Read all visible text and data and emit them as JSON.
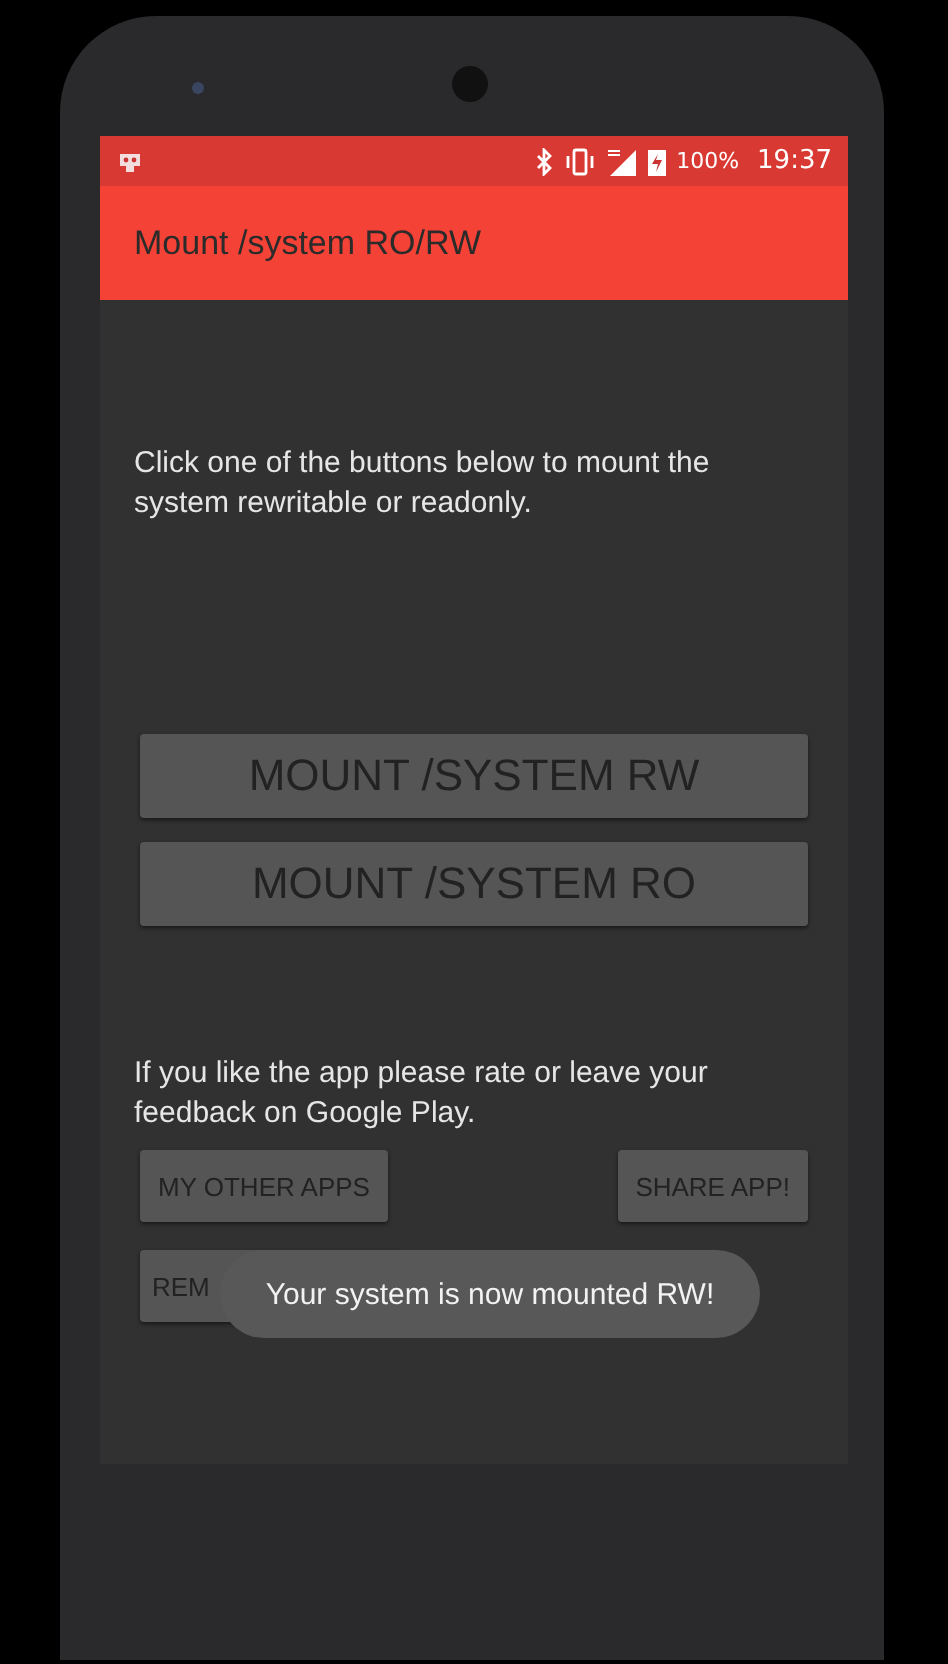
{
  "status_bar": {
    "battery": "100%",
    "time": "19:37"
  },
  "app_bar": {
    "title": "Mount /system RO/RW"
  },
  "intro": "Click one of the buttons below to mount the system rewritable or readonly.",
  "mount_buttons": [
    "MOUNT /SYSTEM RW",
    "MOUNT /SYSTEM RO"
  ],
  "rate_text": "If you like the app please rate or leave your feedback on Google Play.",
  "app_buttons": [
    "MY OTHER APPS",
    "SHARE APP!"
  ],
  "partial_button": "REM",
  "toast": "Your system is now mounted RW!"
}
